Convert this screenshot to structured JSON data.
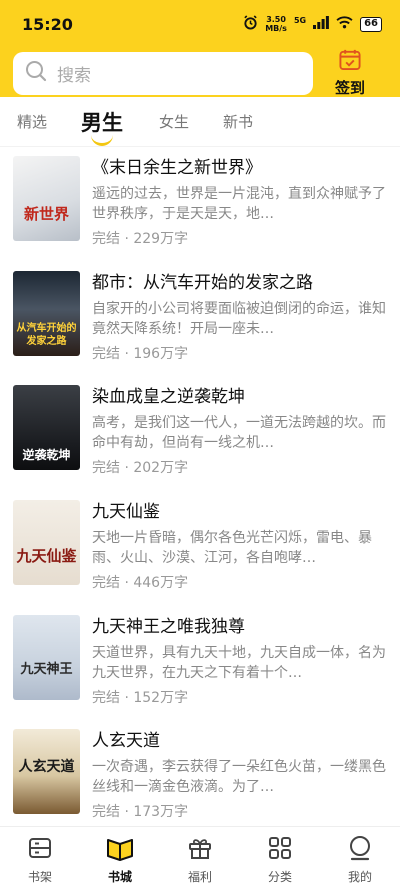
{
  "status": {
    "time": "15:20",
    "speed_value": "3.50",
    "speed_unit": "MB/s",
    "network": "5G",
    "battery": "66"
  },
  "header": {
    "search_placeholder": "搜索",
    "checkin_label": "签到",
    "accent": "#fcd21e"
  },
  "tabs": [
    {
      "label": "精选"
    },
    {
      "label": "男生",
      "active": true
    },
    {
      "label": "女生"
    },
    {
      "label": "新书"
    }
  ],
  "books": [
    {
      "title": "《末日余生之新世界》",
      "desc": "遥远的过去，世界是一片混沌，直到众神赋予了世界秩序，于是天是天，地…",
      "status": "完结",
      "words": "229万字",
      "cover_text": "新世界"
    },
    {
      "title": "都市：从汽车开始的发家之路",
      "desc": "自家开的小公司将要面临被迫倒闭的命运，谁知竟然天降系统！开局一座未…",
      "status": "完结",
      "words": "196万字",
      "cover_text": "从汽车开始的发家之路"
    },
    {
      "title": "染血成皇之逆袭乾坤",
      "desc": "高考，是我们这一代人，一道无法跨越的坎。而命中有劫，但尚有一线之机…",
      "status": "完结",
      "words": "202万字",
      "cover_text": "逆袭乾坤"
    },
    {
      "title": "九天仙鉴",
      "desc": "天地一片昏暗，偶尔各色光芒闪烁，雷电、暴雨、火山、沙漠、江河，各自咆哮…",
      "status": "完结",
      "words": "446万字",
      "cover_text": "九天仙鉴"
    },
    {
      "title": "九天神王之唯我独尊",
      "desc": "天道世界，具有九天十地，九天自成一体，名为九天世界，在九天之下有着十个…",
      "status": "完结",
      "words": "152万字",
      "cover_text": "九天神王"
    },
    {
      "title": "人玄天道",
      "desc": "一次奇遇，李云获得了一朵红色火苗，一缕黑色丝线和一滴金色液滴。为了…",
      "status": "完结",
      "words": "173万字",
      "cover_text": "人玄天道"
    }
  ],
  "separator": "·",
  "nav": [
    {
      "label": "书架",
      "icon": "bookshelf-icon"
    },
    {
      "label": "书城",
      "icon": "bookstore-icon",
      "active": true
    },
    {
      "label": "福利",
      "icon": "gift-icon"
    },
    {
      "label": "分类",
      "icon": "category-icon"
    },
    {
      "label": "我的",
      "icon": "profile-icon"
    }
  ]
}
